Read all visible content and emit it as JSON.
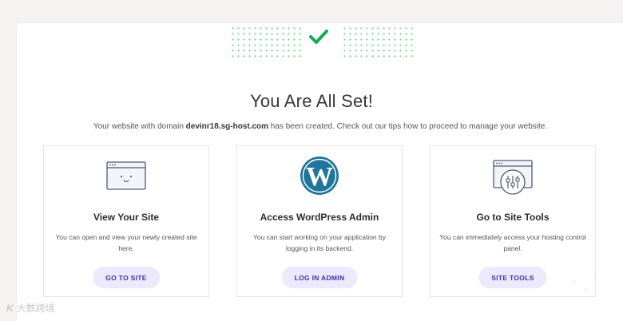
{
  "header": {
    "title": "You Are All Set!",
    "subtitle_before": "Your website with domain ",
    "domain": "devinr18.sg-host.com",
    "subtitle_after": " has been created. Check out our tips how to proceed to manage your website."
  },
  "cards": [
    {
      "icon": "browser-smile-icon",
      "title": "View Your Site",
      "description": "You can open and view your newly created site here.",
      "button": "GO TO SITE"
    },
    {
      "icon": "wordpress-logo-icon",
      "title": "Access WordPress Admin",
      "description": "You can start working on your application by logging in its backend.",
      "button": "LOG IN ADMIN"
    },
    {
      "icon": "site-tools-sliders-icon",
      "title": "Go to Site Tools",
      "description": "You can immediately access your hosting control panel.",
      "button": "SITE TOOLS"
    }
  ],
  "watermark": {
    "logo": "K",
    "text": "大数跨境"
  },
  "colors": {
    "background": "#f4f3f1",
    "panel": "#ffffff",
    "success_green": "#1aa852",
    "button_bg": "#ebe9fb",
    "button_text": "#3e33a8",
    "wordpress_blue": "#21759b"
  }
}
